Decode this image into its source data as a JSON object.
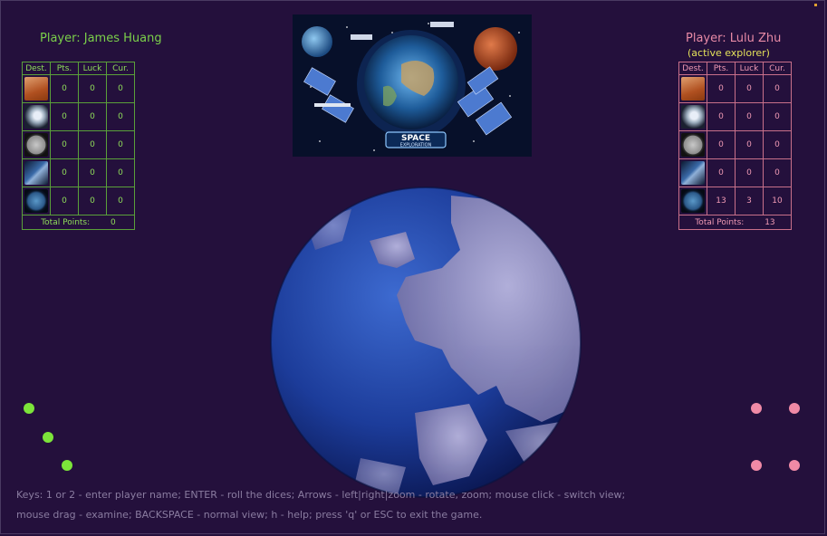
{
  "players": [
    {
      "title": "Player: James Huang",
      "subtitle": "",
      "headers": [
        "Dest.",
        "Pts.",
        "Luck",
        "Cur."
      ],
      "rows": [
        {
          "dest_icon": "mars-icon",
          "pts": "0",
          "luck": "0",
          "cur": "0"
        },
        {
          "dest_icon": "space-station-icon",
          "pts": "0",
          "luck": "0",
          "cur": "0"
        },
        {
          "dest_icon": "moon-icon",
          "pts": "0",
          "luck": "0",
          "cur": "0"
        },
        {
          "dest_icon": "satellite-icon",
          "pts": "0",
          "luck": "0",
          "cur": "0"
        },
        {
          "dest_icon": "earth-icon",
          "pts": "0",
          "luck": "0",
          "cur": "0"
        }
      ],
      "total_label": "Total Points:",
      "total": "0",
      "color": "#7bd04a"
    },
    {
      "title": "Player: Lulu Zhu",
      "subtitle": "(active explorer)",
      "headers": [
        "Dest.",
        "Pts.",
        "Luck",
        "Cur."
      ],
      "rows": [
        {
          "dest_icon": "mars-icon",
          "pts": "0",
          "luck": "0",
          "cur": "0"
        },
        {
          "dest_icon": "space-station-icon",
          "pts": "0",
          "luck": "0",
          "cur": "0"
        },
        {
          "dest_icon": "moon-icon",
          "pts": "0",
          "luck": "0",
          "cur": "0"
        },
        {
          "dest_icon": "satellite-icon",
          "pts": "0",
          "luck": "0",
          "cur": "0"
        },
        {
          "dest_icon": "earth-icon",
          "pts": "13",
          "luck": "3",
          "cur": "10"
        }
      ],
      "total_label": "Total Points:",
      "total": "13",
      "color": "#e88aa6"
    }
  ],
  "banner": {
    "badge_line1": "SPACE",
    "badge_line2": "EXPLORATION"
  },
  "dice": {
    "left_pips": 3,
    "left_color": "#7ce43a",
    "right_pips": 4,
    "right_color": "#f08aa6"
  },
  "help": {
    "line1": "Keys: 1 or 2 - enter player name; ENTER - roll the dices; Arrows - left|right|zoom - rotate, zoom; mouse  click - switch view;",
    "line2": "mouse drag - examine; BACKSPACE - normal view; h - help; press 'q' or ESC to exit the game."
  },
  "colors": {
    "background": "#24103c",
    "player1": "#7bd04a",
    "player2": "#e88aa6",
    "active": "#e3e05a"
  }
}
